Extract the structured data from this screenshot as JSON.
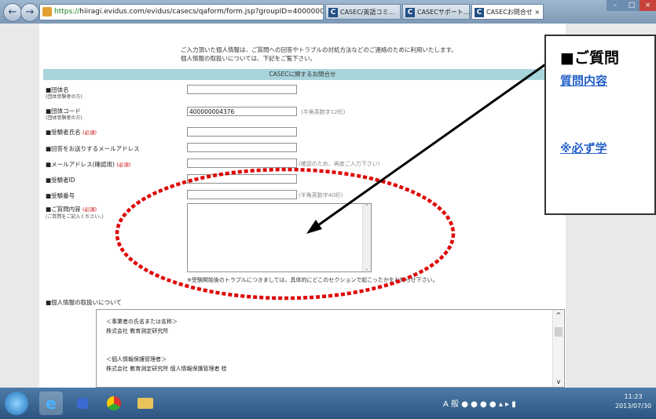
{
  "browser": {
    "address_scheme": "https://",
    "address_rest": "hiiragi.evidus.com/evidus/casecs/qaform/form.jsp?groupID=4000000",
    "address_tools": "ρ ▾ 🔒 ≣ C",
    "tabs": [
      {
        "label": "CASEC/英語コミ..."
      },
      {
        "label": "CASECサポート..."
      },
      {
        "label": "CASECお問合せ"
      }
    ],
    "tab_close": "×"
  },
  "form": {
    "intro_line1": "ご入力頂いた個人情報は、ご質問への回答やトラブルの対処方法などのご連絡のために利用いたします。",
    "intro_line2": "個人情報の取扱いについては、下記をご覧下さい。",
    "section_title": "CASECに関するお問合せ",
    "required_mark": "(必須)",
    "fields": [
      {
        "label": "■団体名",
        "sub": "(団体受験者の方)",
        "value": "",
        "hint": ""
      },
      {
        "label": "■団体コード",
        "sub": "(団体受験者の方)",
        "value": "400000004376",
        "hint": "(半角英数字12桁)"
      },
      {
        "label": "■受験者氏名",
        "sub": "",
        "value": "",
        "hint": ""
      },
      {
        "label": "■回答をお送りするメールアドレス",
        "sub": "",
        "value": "",
        "hint": ""
      },
      {
        "label": "■メールアドレス(確認用)",
        "sub": "",
        "value": "",
        "hint": "(確認のため、再度ご入力下さい)"
      },
      {
        "label": "■受験者ID",
        "sub": "",
        "value": "",
        "hint": ""
      },
      {
        "label": "■受験番号",
        "sub": "",
        "value": "",
        "hint": "(半角英数字40桁)"
      }
    ],
    "question_label": "■ご質問内容",
    "question_sub": "(ご質問をご記入ください。)",
    "question_note": "※受験開始後のトラブルにつきましては、具体的にどこのセクションで起こったかをお知らせ下さい。",
    "privacy_heading": "■個人情報の取扱いについて",
    "privacy_lines": [
      "＜事業者の氏名または名称＞",
      "株式会社 教育測定研究所",
      "＜個人情報保護管理者＞",
      "株式会社 教育測定研究所 個人情報保護管理者 桂"
    ]
  },
  "callout": {
    "line1": "■ご質問",
    "line2": "質問内容",
    "line3": "※必ず学"
  },
  "taskbar": {
    "tray_text": "A 般",
    "time": "11:23",
    "date": "2013/07/30"
  },
  "colors": {
    "section_bar": "#a8d4dc",
    "required": "#cc0000",
    "callout_link": "#2560c8",
    "ellipse": "#e00000"
  }
}
